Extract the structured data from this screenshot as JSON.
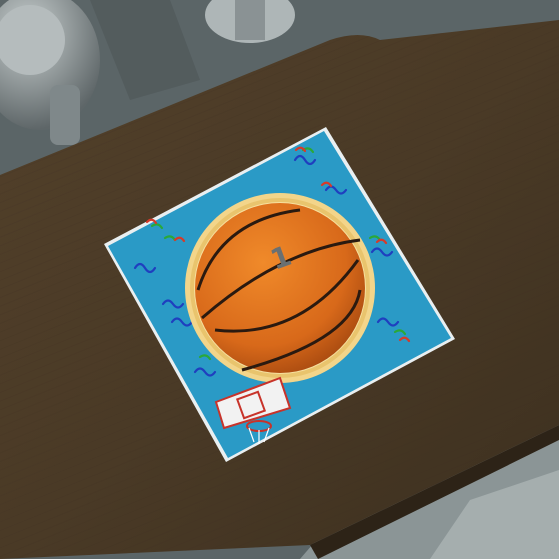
{
  "scene": {
    "description_label": "",
    "cake": {
      "topper_number": "1"
    }
  },
  "colors": {
    "table_wood": "#4a3a26",
    "table_wood_dark": "#36291a",
    "floor": "#6f7a7c",
    "chair_metal": "#9aa3a4",
    "board_blue": "#2a9ac6",
    "board_edge": "#e7eef0",
    "ball_orange": "#e0761c",
    "ball_seam": "#2a1a10",
    "frosting_border": "#f3d58a",
    "hoop_red": "#c8332a"
  },
  "icons": {
    "ball": "basketball-icon",
    "hoop": "basketball-hoop-icon",
    "confetti": "confetti-swirl-icon",
    "topper": "number-topper-icon"
  }
}
